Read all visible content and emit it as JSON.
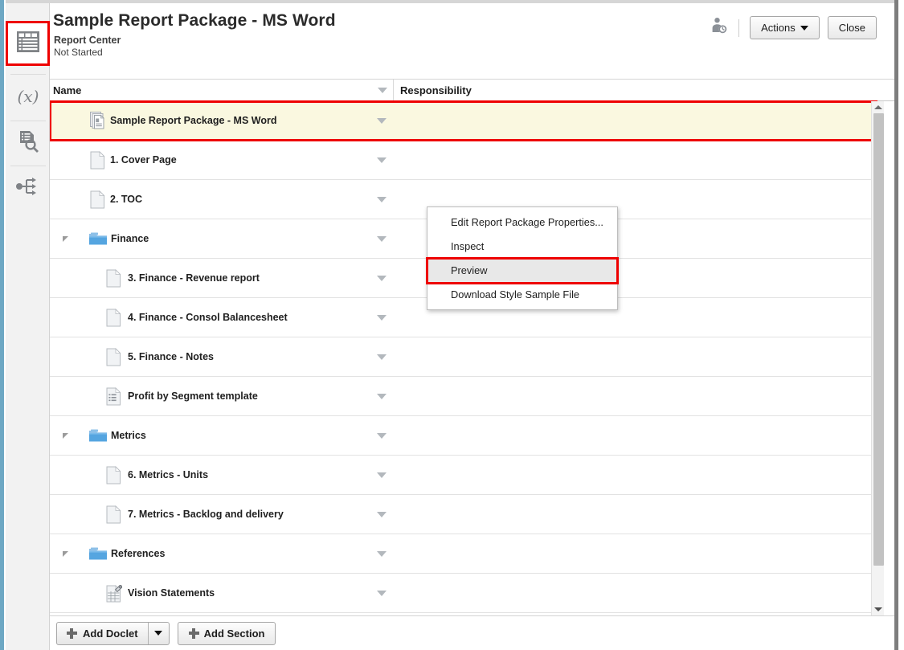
{
  "window": {
    "accent_blue": "#6ea8c4",
    "highlight_red": "#ee0000",
    "selected_row_bg": "#faf8e0"
  },
  "sidebar": {
    "items": [
      {
        "name": "report-center",
        "icon": "report-table-icon",
        "active": true
      },
      {
        "name": "variables",
        "icon": "variable-x-icon",
        "active": false
      },
      {
        "name": "review",
        "icon": "document-search-icon",
        "active": false
      },
      {
        "name": "workflow",
        "icon": "workflow-branch-icon",
        "active": false
      }
    ]
  },
  "header": {
    "title": "Sample Report Package - MS Word",
    "subtitle": "Report Center",
    "status": "Not Started",
    "user_icon": "user-clock-icon",
    "actions_label": "Actions",
    "close_label": "Close"
  },
  "table": {
    "columns": {
      "name": "Name",
      "responsibility": "Responsibility"
    },
    "sort_icon": "sort-descending-icon",
    "row_menu_icon": "row-menu-arrow-icon",
    "rows": [
      {
        "label": "Sample Report Package - MS Word",
        "icon": "report-package-icon",
        "indent": 0,
        "type": "package",
        "selected": true,
        "has_menu": true,
        "expandable": false
      },
      {
        "label": "1. Cover Page",
        "icon": "doclet-icon",
        "indent": 1,
        "type": "doclet",
        "selected": false,
        "has_menu": true,
        "expandable": false
      },
      {
        "label": "2. TOC",
        "icon": "doclet-icon",
        "indent": 1,
        "type": "doclet",
        "selected": false,
        "has_menu": true,
        "expandable": false
      },
      {
        "label": "Finance",
        "icon": "folder-icon",
        "indent": 0,
        "type": "section",
        "selected": false,
        "has_menu": true,
        "expandable": true
      },
      {
        "label": "3. Finance - Revenue report",
        "icon": "doclet-icon",
        "indent": 2,
        "type": "doclet",
        "selected": false,
        "has_menu": true,
        "expandable": false
      },
      {
        "label": "4. Finance - Consol Balancesheet",
        "icon": "doclet-icon",
        "indent": 2,
        "type": "doclet",
        "selected": false,
        "has_menu": true,
        "expandable": false
      },
      {
        "label": "5. Finance - Notes",
        "icon": "doclet-icon",
        "indent": 2,
        "type": "doclet",
        "selected": false,
        "has_menu": true,
        "expandable": false
      },
      {
        "label": "Profit by Segment template",
        "icon": "supplemental-doclet-icon",
        "indent": 2,
        "type": "supplemental",
        "selected": false,
        "has_menu": true,
        "expandable": false
      },
      {
        "label": "Metrics",
        "icon": "folder-icon",
        "indent": 0,
        "type": "section",
        "selected": false,
        "has_menu": true,
        "expandable": true
      },
      {
        "label": "6. Metrics - Units",
        "icon": "doclet-icon",
        "indent": 2,
        "type": "doclet",
        "selected": false,
        "has_menu": true,
        "expandable": false
      },
      {
        "label": "7. Metrics - Backlog and delivery",
        "icon": "doclet-icon",
        "indent": 2,
        "type": "doclet",
        "selected": false,
        "has_menu": true,
        "expandable": false
      },
      {
        "label": "References",
        "icon": "folder-icon",
        "indent": 0,
        "type": "section",
        "selected": false,
        "has_menu": true,
        "expandable": true
      },
      {
        "label": "Vision Statements",
        "icon": "reference-doclet-icon",
        "indent": 2,
        "type": "reference",
        "selected": false,
        "has_menu": true,
        "expandable": false
      }
    ]
  },
  "context_menu": {
    "items": [
      {
        "label": "Edit Report Package Properties...",
        "highlighted": false
      },
      {
        "label": "Inspect",
        "highlighted": false
      },
      {
        "label": "Preview",
        "highlighted": true
      },
      {
        "label": "Download Style Sample File",
        "highlighted": false
      }
    ]
  },
  "footer": {
    "add_doclet_label": "Add Doclet",
    "add_section_label": "Add Section"
  },
  "scrollbar": {
    "up_icon": "scroll-up-icon",
    "down_icon": "scroll-down-icon"
  }
}
